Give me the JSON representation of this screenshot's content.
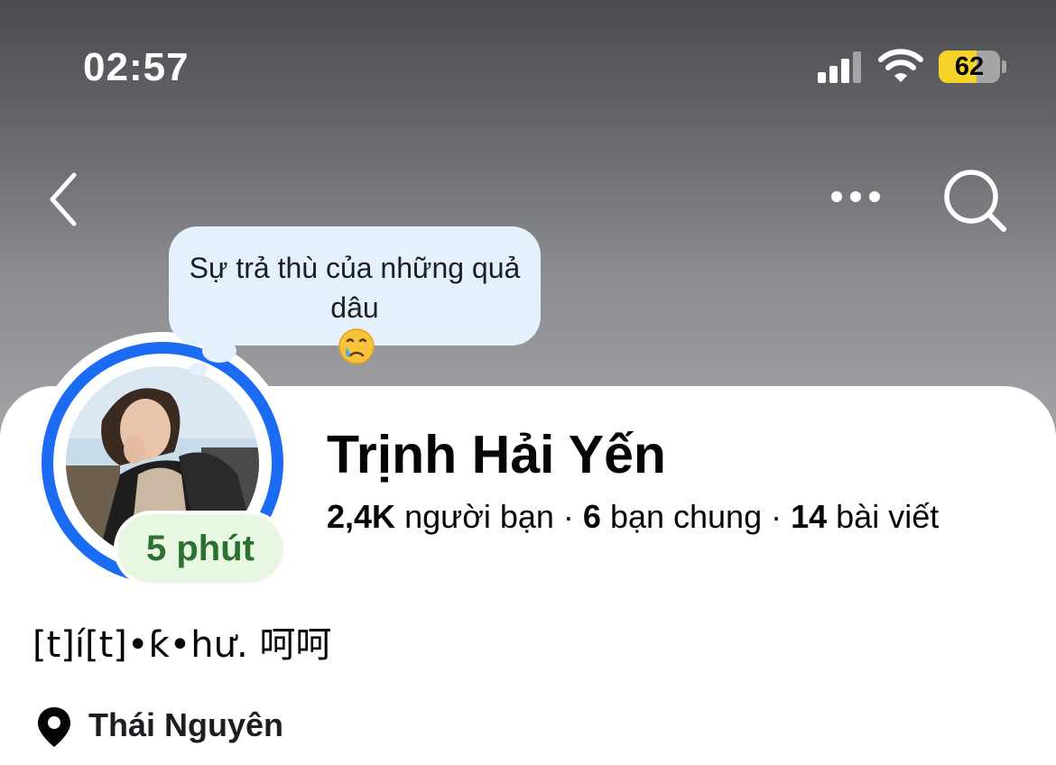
{
  "status_bar": {
    "time": "02:57",
    "battery_percent": "62",
    "battery_level": 0.62,
    "signal_bars": 3
  },
  "nav": {
    "back_icon": "chevron-left-icon",
    "more_icon": "ellipsis-icon",
    "search_icon": "search-icon"
  },
  "note": {
    "text": "Sự trả thù của những quả dâu",
    "emoji": "crying-face-emoji"
  },
  "avatar": {
    "story_ring_color": "#1b6cf2",
    "active_badge": "5 phút"
  },
  "profile": {
    "name": "Trịnh Hải Yến",
    "friends_count": "2,4K",
    "friends_label": "người bạn",
    "mutual_count": "6",
    "mutual_label": "bạn chung",
    "posts_count": "14",
    "posts_label": "bài viết",
    "separator": "·",
    "bio": "[t]í[t]•ƙ•hư.   呵呵",
    "location": "Thái Nguyên",
    "location_icon": "location-pin-icon"
  },
  "colors": {
    "badge_text": "#2e7030",
    "badge_bg": "#e8f7e2",
    "note_bg": "#e4f1fc",
    "battery_fill": "#f5d328"
  }
}
